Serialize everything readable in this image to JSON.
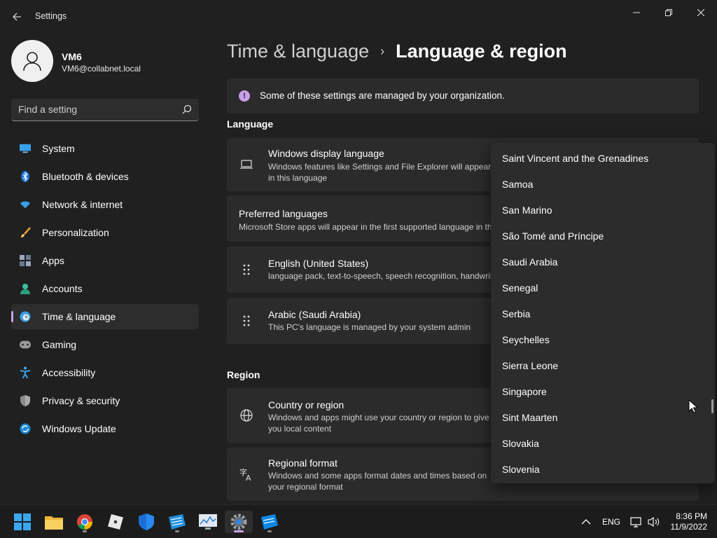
{
  "window": {
    "title": "Settings"
  },
  "user": {
    "name": "VM6",
    "email": "VM6@collabnet.local"
  },
  "search": {
    "placeholder": "Find a setting"
  },
  "sidebar": {
    "items": [
      {
        "label": "System",
        "icon": "system-icon"
      },
      {
        "label": "Bluetooth & devices",
        "icon": "bluetooth-icon"
      },
      {
        "label": "Network & internet",
        "icon": "wifi-icon"
      },
      {
        "label": "Personalization",
        "icon": "brush-icon"
      },
      {
        "label": "Apps",
        "icon": "apps-icon"
      },
      {
        "label": "Accounts",
        "icon": "accounts-icon"
      },
      {
        "label": "Time & language",
        "icon": "time-language-icon",
        "active": true
      },
      {
        "label": "Gaming",
        "icon": "gaming-icon"
      },
      {
        "label": "Accessibility",
        "icon": "accessibility-icon"
      },
      {
        "label": "Privacy & security",
        "icon": "shield-icon"
      },
      {
        "label": "Windows Update",
        "icon": "update-icon"
      }
    ]
  },
  "breadcrumb": {
    "parent": "Time & language",
    "separator": "›",
    "current": "Language & region"
  },
  "infobar": {
    "icon": "info-icon",
    "text": "Some of these settings are managed by your organization."
  },
  "language": {
    "heading": "Language",
    "display_language": {
      "title": "Windows display language",
      "desc": "Windows features like Settings and File Explorer will appear in this language"
    },
    "preferred": {
      "title": "Preferred languages",
      "desc": "Microsoft Store apps will appear in the first supported language in this list"
    },
    "english": {
      "title": "English (United States)",
      "desc": "language pack, text-to-speech, speech recognition, handwriting, basic typing"
    },
    "arabic": {
      "title": "Arabic (Saudi Arabia)",
      "desc": "This PC's language is managed by your system admin"
    }
  },
  "region": {
    "heading": "Region",
    "country": {
      "title": "Country or region",
      "desc": "Windows and apps might use your country or region to give you local content"
    },
    "format": {
      "title": "Regional format",
      "desc": "Windows and some apps format dates and times based on your regional format"
    }
  },
  "dropdown": {
    "items": [
      "Saint Vincent and the Grenadines",
      "Samoa",
      "San Marino",
      "São Tomé and Príncipe",
      "Saudi Arabia",
      "Senegal",
      "Serbia",
      "Seychelles",
      "Sierra Leone",
      "Singapore",
      "Sint Maarten",
      "Slovakia",
      "Slovenia"
    ]
  },
  "taskbar": {
    "apps": [
      "start-icon",
      "file-explorer-icon",
      "chrome-icon",
      "roblox-icon",
      "defender-icon",
      "azure-icon",
      "monitor-icon",
      "settings-icon",
      "remote-desktop-icon"
    ],
    "language": "ENG",
    "time": "8:36 PM",
    "date": "11/9/2022"
  },
  "colors": {
    "accent": "#c4a4e8",
    "background": "#202020",
    "card": "#2b2b2b"
  }
}
